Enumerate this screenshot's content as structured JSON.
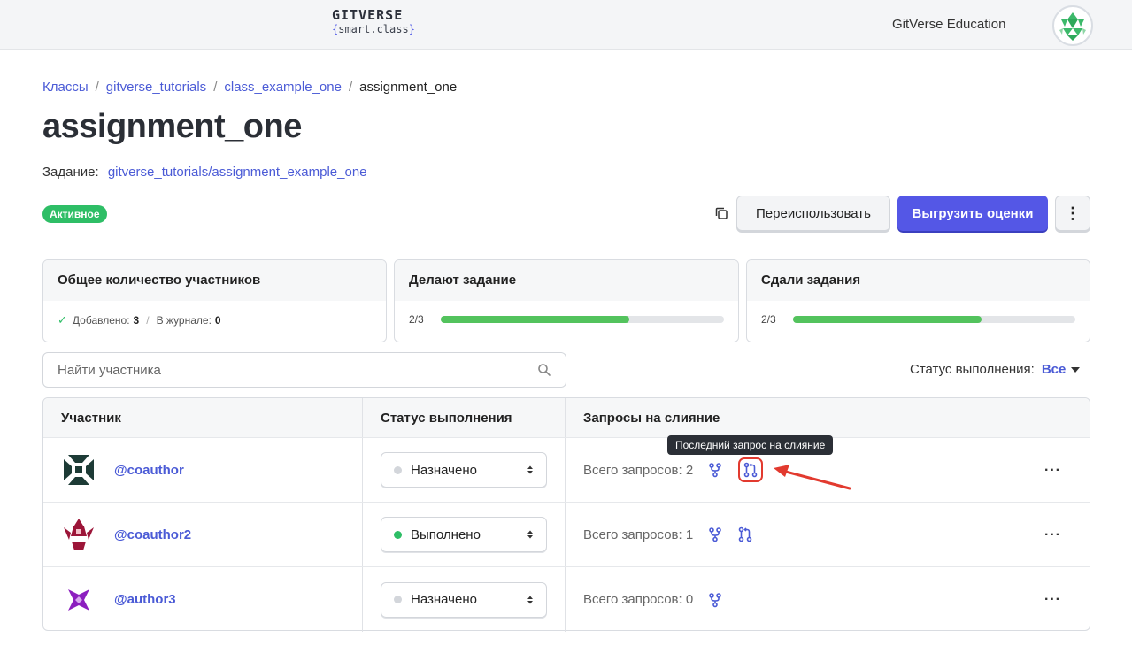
{
  "header": {
    "logo_main": "GITVERSE",
    "logo_sub": "smart.class",
    "org_name": "GitVerse Education"
  },
  "breadcrumb": {
    "items": [
      "Классы",
      "gitverse_tutorials",
      "class_example_one"
    ],
    "current": "assignment_one",
    "separator": "/"
  },
  "page": {
    "title": "assignment_one",
    "assignment_label": "Задание:",
    "assignment_link": "gitverse_tutorials/assignment_example_one",
    "status_badge": "Активное",
    "status_color": "#2ebe66"
  },
  "actions": {
    "reuse_label": "Переиспользовать",
    "export_label": "Выгрузить оценки",
    "more_label": "⋮",
    "accent_color": "#5457e6"
  },
  "stats": {
    "total": {
      "title": "Общее количество участников",
      "added_label": "Добавлено:",
      "added_value": "3",
      "journal_label": "В журнале:",
      "journal_value": "0"
    },
    "doing": {
      "title": "Делают задание",
      "progress_text": "2/3",
      "progress_fraction": 0.667
    },
    "submitted": {
      "title": "Сдали задания",
      "progress_text": "2/3",
      "progress_fraction": 0.667
    }
  },
  "search": {
    "placeholder": "Найти участника"
  },
  "filter": {
    "label": "Статус выполнения:",
    "value": "Все"
  },
  "table": {
    "headers": [
      "Участник",
      "Статус выполнения",
      "Запросы на слияние"
    ],
    "rows": [
      {
        "username": "@coauthor",
        "status": "Назначено",
        "status_dot": "grey",
        "mr_text": "Всего запросов: 2",
        "has_last_mr": true
      },
      {
        "username": "@coauthor2",
        "status": "Выполнено",
        "status_dot": "green",
        "mr_text": "Всего запросов: 1",
        "has_last_mr": true
      },
      {
        "username": "@author3",
        "status": "Назначено",
        "status_dot": "grey",
        "mr_text": "Всего запросов: 0",
        "has_last_mr": false
      }
    ],
    "row_more_label": "···"
  },
  "tooltip": {
    "text": "Последний запрос на слияние"
  }
}
